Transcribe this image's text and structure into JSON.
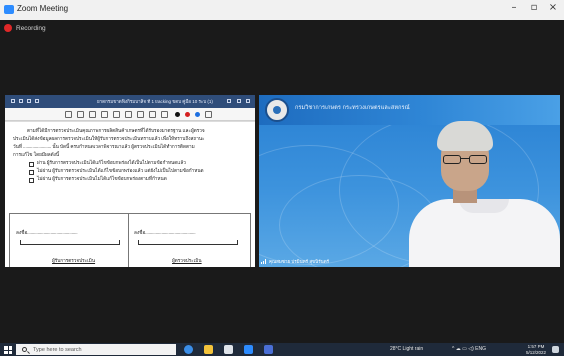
{
  "window": {
    "title": "Zoom Meeting",
    "controls": {
      "minimize": "–",
      "maximize": "▫",
      "close": "×"
    }
  },
  "recording": {
    "label": "Recording",
    "color": "#e02828"
  },
  "shared_screen": {
    "app_title": "ยาดกรมขาดฟิงกิรมบาสิจ ที 1 tracking ขดบ คู่มือ 10 ระบ (1)",
    "document": {
      "paragraph_lines": [
        "ตามที่ได้มีการตรวจประเมินคุณภาพการผลิตสินค้าเกษตรที่ได้รับรองมาตรฐาน  และผู้ตรวจ",
        "ประเมินได้ส่งข้อมูลผลการตรวจประเมินให้ผู้รับการตรวจประเมินทราบแล้ว เพื่อให้ทราบถึงสถานะ",
        "วันที่ ........................ นั้น บัดนี้ ครบกำหนดเวลาพิจารณาแล้ว ผู้ตรวจประเมินได้ทำการติดตาม",
        "การแก้ไข โดยมีผลดังนี้"
      ],
      "options": [
        "ผ่าน  ผู้รับการตรวจประเมินได้แก้ไขข้อบกพร่องได้เป็นไปตามข้อกำหนดแล้ว",
        "ไม่ผ่าน  ผู้รับการตรวจประเมินได้แก้ไขข้อบกพร่องแล้ว แต่ยังไม่เป็นไปตามข้อกำหนด",
        "ไม่ผ่าน  ผู้รับการตรวจประเมินไม่ได้แก้ไขข้อบกพร่องตามที่กำหนด"
      ],
      "signature_left": "ลงชื่อ...........................................",
      "signature_right": "ลงชื่อ...........................................",
      "caption_left": "ผู้รับการตรวจประเมิน",
      "caption_right": "ผู้ตรวจประเมิน"
    }
  },
  "video": {
    "banner_text": "กรมวิชาการเกษตร กระทรวงเกษตรและสหกรณ์",
    "participant_name": "คุณสมชาย ปรมินทร์ สุขนิรันดร์"
  },
  "taskbar": {
    "search_placeholder": "Type here to search",
    "weather": "28°C  Light rain",
    "tray_icons": "^  ☁  ▭  ◁)  ENG",
    "time": "1:57 PM",
    "date": "5/12/2022"
  },
  "colors": {
    "zoom_blue": "#2d8cff",
    "taskbar": "#1f2a3a",
    "video_bg": "#2f86d6"
  }
}
